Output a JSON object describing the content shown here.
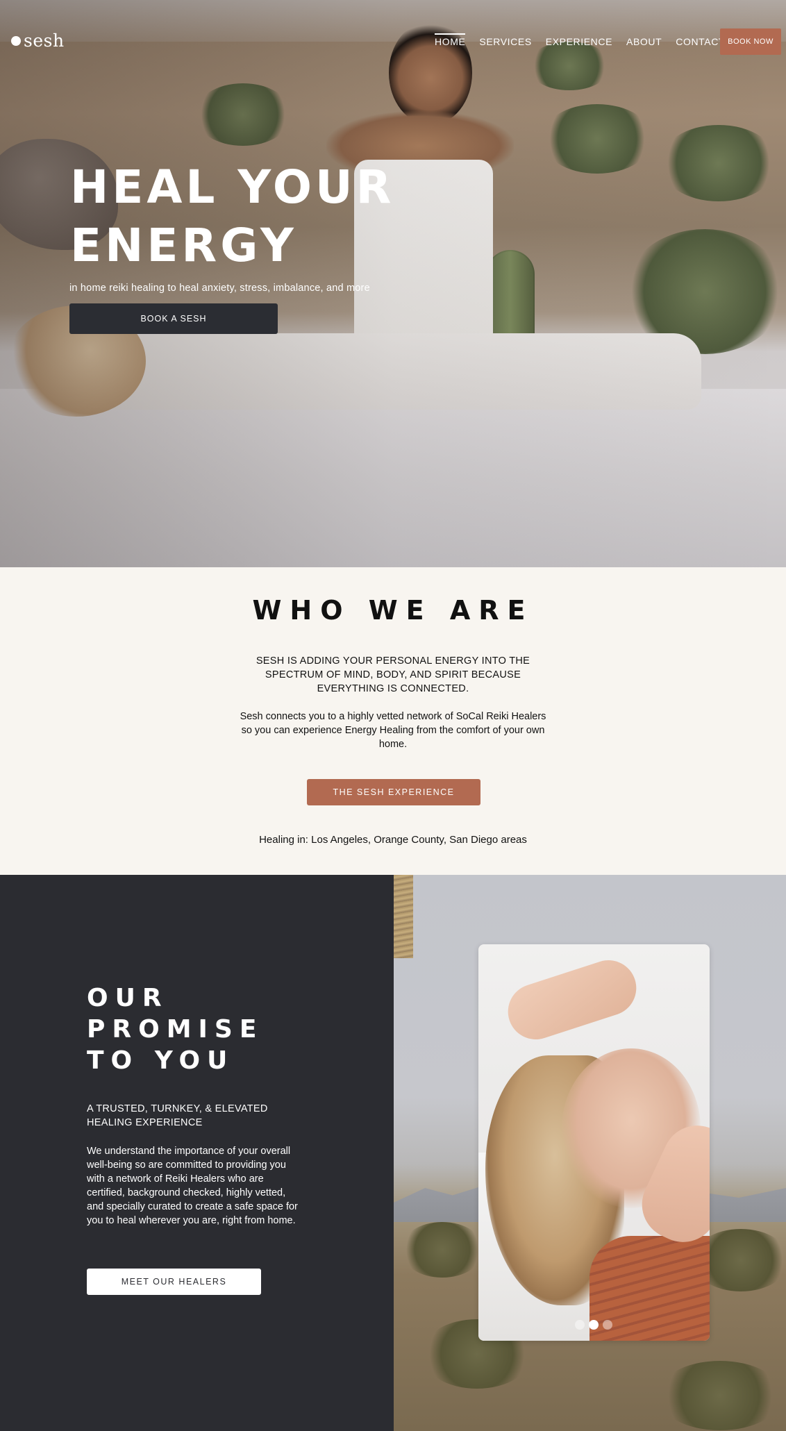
{
  "nav": {
    "logo": "sesh",
    "links": [
      "HOME",
      "SERVICES",
      "EXPERIENCE",
      "ABOUT",
      "CONTACT"
    ],
    "active_link": "HOME",
    "book_now": "BOOK NOW"
  },
  "hero": {
    "title": "HEAL YOUR ENERGY",
    "subtitle": "in home reiki healing to heal anxiety, stress, imbalance, and more",
    "cta": "BOOK A SESH"
  },
  "who": {
    "title": "WHO WE ARE",
    "lead": "SESH IS ADDING YOUR PERSONAL ENERGY INTO THE SPECTRUM OF MIND, BODY, AND SPIRIT BECAUSE EVERYTHING IS CONNECTED.",
    "body": "Sesh connects you to a highly vetted network of SoCal Reiki Healers so you can experience Energy Healing from the comfort of your own home.",
    "cta": "THE SESH EXPERIENCE",
    "areas": "Healing in: Los Angeles, Orange County, San Diego areas"
  },
  "promise": {
    "title": "OUR PROMISE TO YOU",
    "lead": "A TRUSTED, TURNKEY, & ELEVATED HEALING EXPERIENCE",
    "body": "We understand the importance of your overall well-being so are committed to providing you with a network of Reiki Healers who are certified, background checked, highly vetted, and specially curated to create a safe space for you to heal wherever you are, right from home.",
    "cta": "MEET OUR HEALERS"
  },
  "carousel": {
    "slide_count": 3,
    "active_index": 1
  },
  "colors": {
    "accent": "#b26a51",
    "dark": "#2b2c31",
    "cream": "#f8f5f0"
  }
}
